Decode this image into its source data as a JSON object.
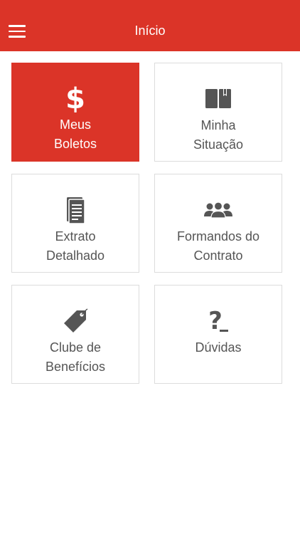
{
  "header": {
    "title": "Início",
    "menu_icon": "hamburger-menu-icon",
    "color": "#db3428"
  },
  "tiles": [
    {
      "line1": "Meus",
      "line2": "Boletos",
      "icon": "dollar-icon",
      "icon_glyph": "$",
      "active": true
    },
    {
      "line1": "Minha",
      "line2": "Situação",
      "icon": "book-icon",
      "active": false
    },
    {
      "line1": "Extrato",
      "line2": "Detalhado",
      "icon": "document-icon",
      "active": false
    },
    {
      "line1": "Formandos do",
      "line2": "Contrato",
      "icon": "users-icon",
      "active": false
    },
    {
      "line1": "Clube de",
      "line2": "Benefícios",
      "icon": "tag-icon",
      "active": false
    },
    {
      "line1": "Dúvidas",
      "icon": "question-icon",
      "icon_glyph": "?",
      "active": false
    }
  ],
  "colors": {
    "accent": "#db3428",
    "tile_border": "#dcdcdc",
    "text": "#555555"
  }
}
